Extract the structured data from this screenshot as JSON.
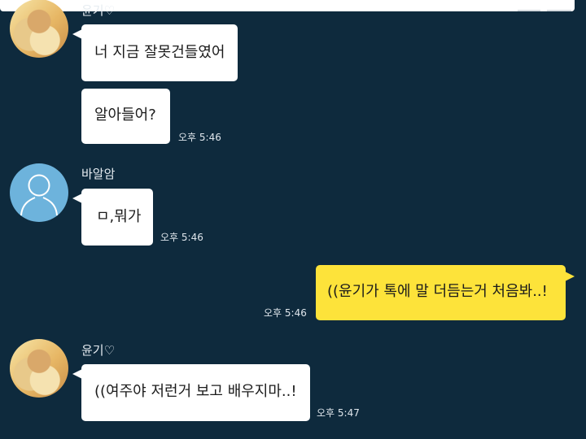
{
  "messages": [
    {
      "sender": "윤기♡",
      "bubbles": [
        "너 지금 잘못건들였어",
        "알아들어?"
      ],
      "time": "오후 5:46"
    },
    {
      "sender": "바알암",
      "bubbles": [
        "ㅁ,뭐가"
      ],
      "time": "오후 5:46"
    },
    {
      "sender": "",
      "bubbles": [
        "((윤기가 톡에 말 더듬는거 처음봐..!"
      ],
      "time": "오후 5:46",
      "mine": true
    },
    {
      "sender": "윤기♡",
      "bubbles": [
        "((여주야 저런거 보고 배우지마..!"
      ],
      "time": "오후 5:47"
    }
  ],
  "colors": {
    "background": "#0e2a3d",
    "own_bubble": "#fde33a",
    "other_bubble": "#ffffff",
    "default_avatar": "#6db3dc"
  }
}
